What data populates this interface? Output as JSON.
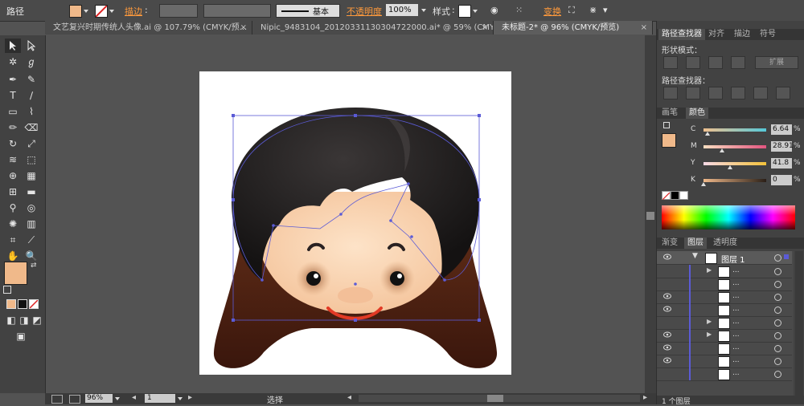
{
  "control_bar": {
    "mode": "路径",
    "stroke_label": "描边",
    "line_style": "基本",
    "opacity_label": "不透明度",
    "opacity_value": "100%",
    "style_label": "样式",
    "transform_label": "变换",
    "fill_color": "#f0b98a"
  },
  "tabs": [
    {
      "label": "文艺复兴时期传统人头像.ai @ 107.79% (CMYK/预..."
    },
    {
      "label": "Nipic_9483104_20120331130304722000.ai* @ 59% (CMY..."
    },
    {
      "label": "未标题-2* @ 96% (CMYK/预览)"
    }
  ],
  "status_bar": {
    "zoom": "96%",
    "page": "1",
    "tool": "选择"
  },
  "pathfinder": {
    "tabs": [
      "路径查找器",
      "对齐",
      "描边",
      "符号"
    ],
    "shape_modes_label": "形状模式：",
    "expand_label": "扩展",
    "pathfinders_label": "路径查找器："
  },
  "color_panel": {
    "tabs": [
      "画笔",
      "颜色"
    ],
    "channels": [
      {
        "name": "C",
        "value": "6.64",
        "pct": 6.64
      },
      {
        "name": "M",
        "value": "28.91",
        "pct": 28.91
      },
      {
        "name": "Y",
        "value": "41.8",
        "pct": 41.8
      },
      {
        "name": "K",
        "value": "0",
        "pct": 0
      }
    ],
    "unit": "%",
    "fill_color": "#f0b98a"
  },
  "layers_panel": {
    "tabs": [
      "渐变",
      "图层",
      "透明度"
    ],
    "layer_name": "图层 1",
    "sublayer_label": "...",
    "footer": "1 个图层"
  },
  "artwork": {
    "hair_color": "#1f1d1d",
    "skin_color": "#fbd9b8",
    "mouth_color": "#e23a25",
    "selection_color": "#5b5bd6"
  }
}
